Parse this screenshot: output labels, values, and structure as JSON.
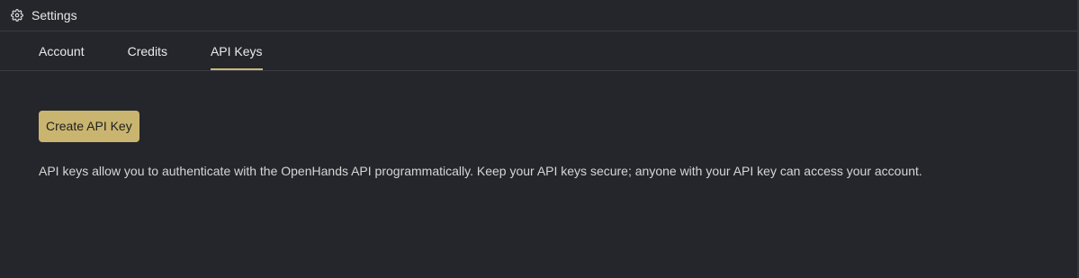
{
  "header": {
    "title": "Settings",
    "icon": "gear-icon"
  },
  "tabs": [
    {
      "label": "Account",
      "active": false
    },
    {
      "label": "Credits",
      "active": false
    },
    {
      "label": "API Keys",
      "active": true
    }
  ],
  "main": {
    "create_button_label": "Create API Key",
    "description": "API keys allow you to authenticate with the OpenHands API programmatically. Keep your API keys secure; anyone with your API key can access your account."
  },
  "colors": {
    "background": "#25262b",
    "accent": "#c9b56f",
    "divider": "#3a3c42"
  }
}
